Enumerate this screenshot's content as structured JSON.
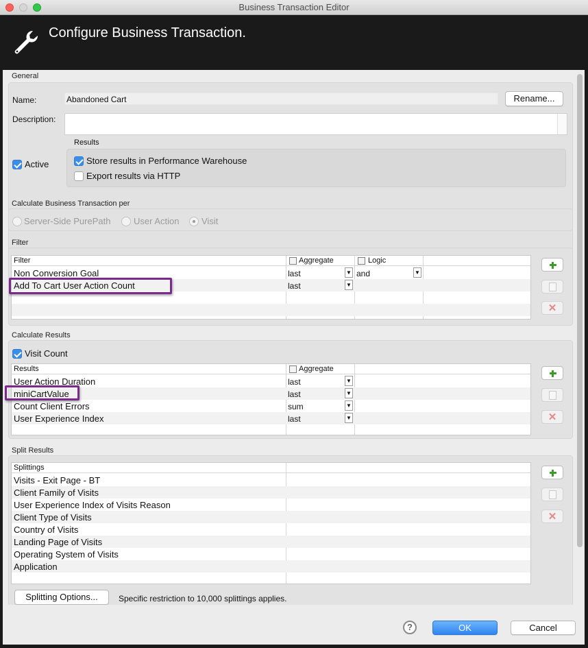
{
  "window": {
    "title": "Business Transaction Editor"
  },
  "header": {
    "title": "Configure Business Transaction.",
    "icon": "wrench-icon"
  },
  "general": {
    "section_label": "General",
    "name_label": "Name:",
    "name_value": "Abandoned Cart",
    "rename_button": "Rename...",
    "description_label": "Description:",
    "description_value": "",
    "active_label": "Active",
    "active_checked": true,
    "results_label": "Results",
    "store_results_label": "Store results in Performance Warehouse",
    "store_results_checked": true,
    "export_results_label": "Export results via HTTP",
    "export_results_checked": false
  },
  "calculate_per": {
    "section_label": "Calculate Business Transaction per",
    "options": [
      "Server-Side PurePath",
      "User Action",
      "Visit"
    ],
    "selected": "Visit"
  },
  "filter": {
    "section_label": "Filter",
    "columns": [
      "Filter",
      "Aggregate",
      "Logic"
    ],
    "rows": [
      {
        "filter": "Non Conversion Goal",
        "aggregate": "last",
        "logic": "and"
      },
      {
        "filter": "Add To Cart User Action Count",
        "aggregate": "last",
        "logic": ""
      }
    ]
  },
  "calculate_results": {
    "section_label": "Calculate Results",
    "visit_count_label": "Visit Count",
    "visit_count_checked": true,
    "columns": [
      "Results",
      "Aggregate"
    ],
    "rows": [
      {
        "result": "User Action Duration",
        "aggregate": "last"
      },
      {
        "result": "miniCartValue",
        "aggregate": "last"
      },
      {
        "result": "Count Client Errors",
        "aggregate": "sum"
      },
      {
        "result": "User Experience Index",
        "aggregate": "last"
      }
    ]
  },
  "split_results": {
    "section_label": "Split Results",
    "column": "Splittings",
    "rows": [
      "Visits - Exit Page - BT",
      "Client Family of Visits",
      "User Experience Index of Visits Reason",
      "Client Type of Visits",
      "Country of Visits",
      "Landing Page of Visits",
      "Operating System of Visits",
      "Application"
    ],
    "options_button": "Splitting Options...",
    "note": "Specific restriction to 10,000 splittings applies."
  },
  "footer": {
    "ok_button": "OK",
    "cancel_button": "Cancel",
    "help_glyph": "?"
  },
  "colors": {
    "accent": "#3b8ee8",
    "highlight": "#7b2a8c",
    "header_bg": "#1a1a1a",
    "add_green": "#3e9a2b",
    "delete_red": "#e28a8a"
  }
}
